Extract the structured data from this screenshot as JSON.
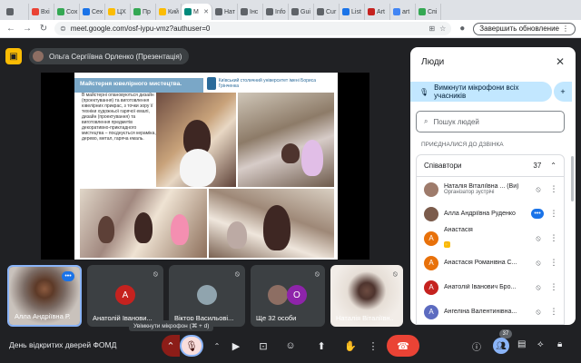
{
  "browser": {
    "tabs": [
      {
        "label": "",
        "color": "#5f6368"
      },
      {
        "label": "Вхі",
        "color": "#ea4335"
      },
      {
        "label": "Сох",
        "color": "#34a853"
      },
      {
        "label": "Сех",
        "color": "#1a73e8"
      },
      {
        "label": "ЦХ",
        "color": "#fbbc04"
      },
      {
        "label": "Пр",
        "color": "#34a853"
      },
      {
        "label": "Кий",
        "color": "#fbbc04"
      },
      {
        "label": "М",
        "color": "#00897b",
        "active": true
      },
      {
        "label": "Нат",
        "color": "#5f6368"
      },
      {
        "label": "Інс",
        "color": "#5f6368"
      },
      {
        "label": "Info",
        "color": "#5f6368"
      },
      {
        "label": "Gui",
        "color": "#5f6368"
      },
      {
        "label": "Cur",
        "color": "#5f6368"
      },
      {
        "label": "List",
        "color": "#1a73e8"
      },
      {
        "label": "Art",
        "color": "#c5221f"
      },
      {
        "label": "art",
        "color": "#4285f4"
      },
      {
        "label": "Спі",
        "color": "#34a853"
      }
    ],
    "url": "meet.google.com/osf-iypu-vmz?authuser=0",
    "update_label": "Завершить обновление"
  },
  "presenter": {
    "label": "Ольга Сергіївна Орленко (Презентація)"
  },
  "slide": {
    "title": "Майстерня ювелірного мистецтва.",
    "logo_text": "Київський столичний університет імені Бориса Грінченка",
    "body": "В майстерні опановуються дизайн (проектування) та виготовлення ювелірних прикрас, з точки зору її техніки художньої гарячої емалі, дизайн (проектування) та виготовлення предметів декоративно-прикладного мистецтва – поєднується кераміка, дерево, метал, гаряча емаль."
  },
  "panel": {
    "title": "Люди",
    "mute_all_label": "Вимкнути мікрофони всіх учасників",
    "search_placeholder": "Пошук людей",
    "joined_label": "ПРИЄДНАЛИСЯ ДО ДЗВІНКА",
    "group_label": "Співавтори",
    "group_count": "37",
    "participants": [
      {
        "name": "Наталія Віталіївна ... (Ви)",
        "role": "Організатор зустрічі",
        "initial": "",
        "color": "#9e7b6b",
        "photo": true
      },
      {
        "name": "Алла Андріївна Руденко",
        "role": "",
        "initial": "",
        "color": "#7b5b4b",
        "photo": true
      },
      {
        "name": "Анастасія",
        "role": "",
        "initial": "А",
        "color": "#e8710a"
      },
      {
        "name": "Анастасія Романівна С...",
        "role": "",
        "initial": "А",
        "color": "#e8710a"
      },
      {
        "name": "Анатолій Іванович Бро...",
        "role": "",
        "initial": "А",
        "color": "#c5221f"
      },
      {
        "name": "Ангеліна Валентинівна...",
        "role": "",
        "initial": "А",
        "color": "#5c6bc0"
      }
    ]
  },
  "tiles": {
    "t1": "Алла Андріївна Р...",
    "t2": "Анатолій Іванови...",
    "t2_initial": "А",
    "t3": "Віктор Васильові...",
    "t4": "Ще 32 особи",
    "t4_initial": "О",
    "t5": "Наталія Віталіївн..."
  },
  "tooltip": "Увімкнути мікрофон (⌘ + d)",
  "meeting": {
    "name": "День відкритих дверей ФОМД",
    "people_count": "37"
  }
}
